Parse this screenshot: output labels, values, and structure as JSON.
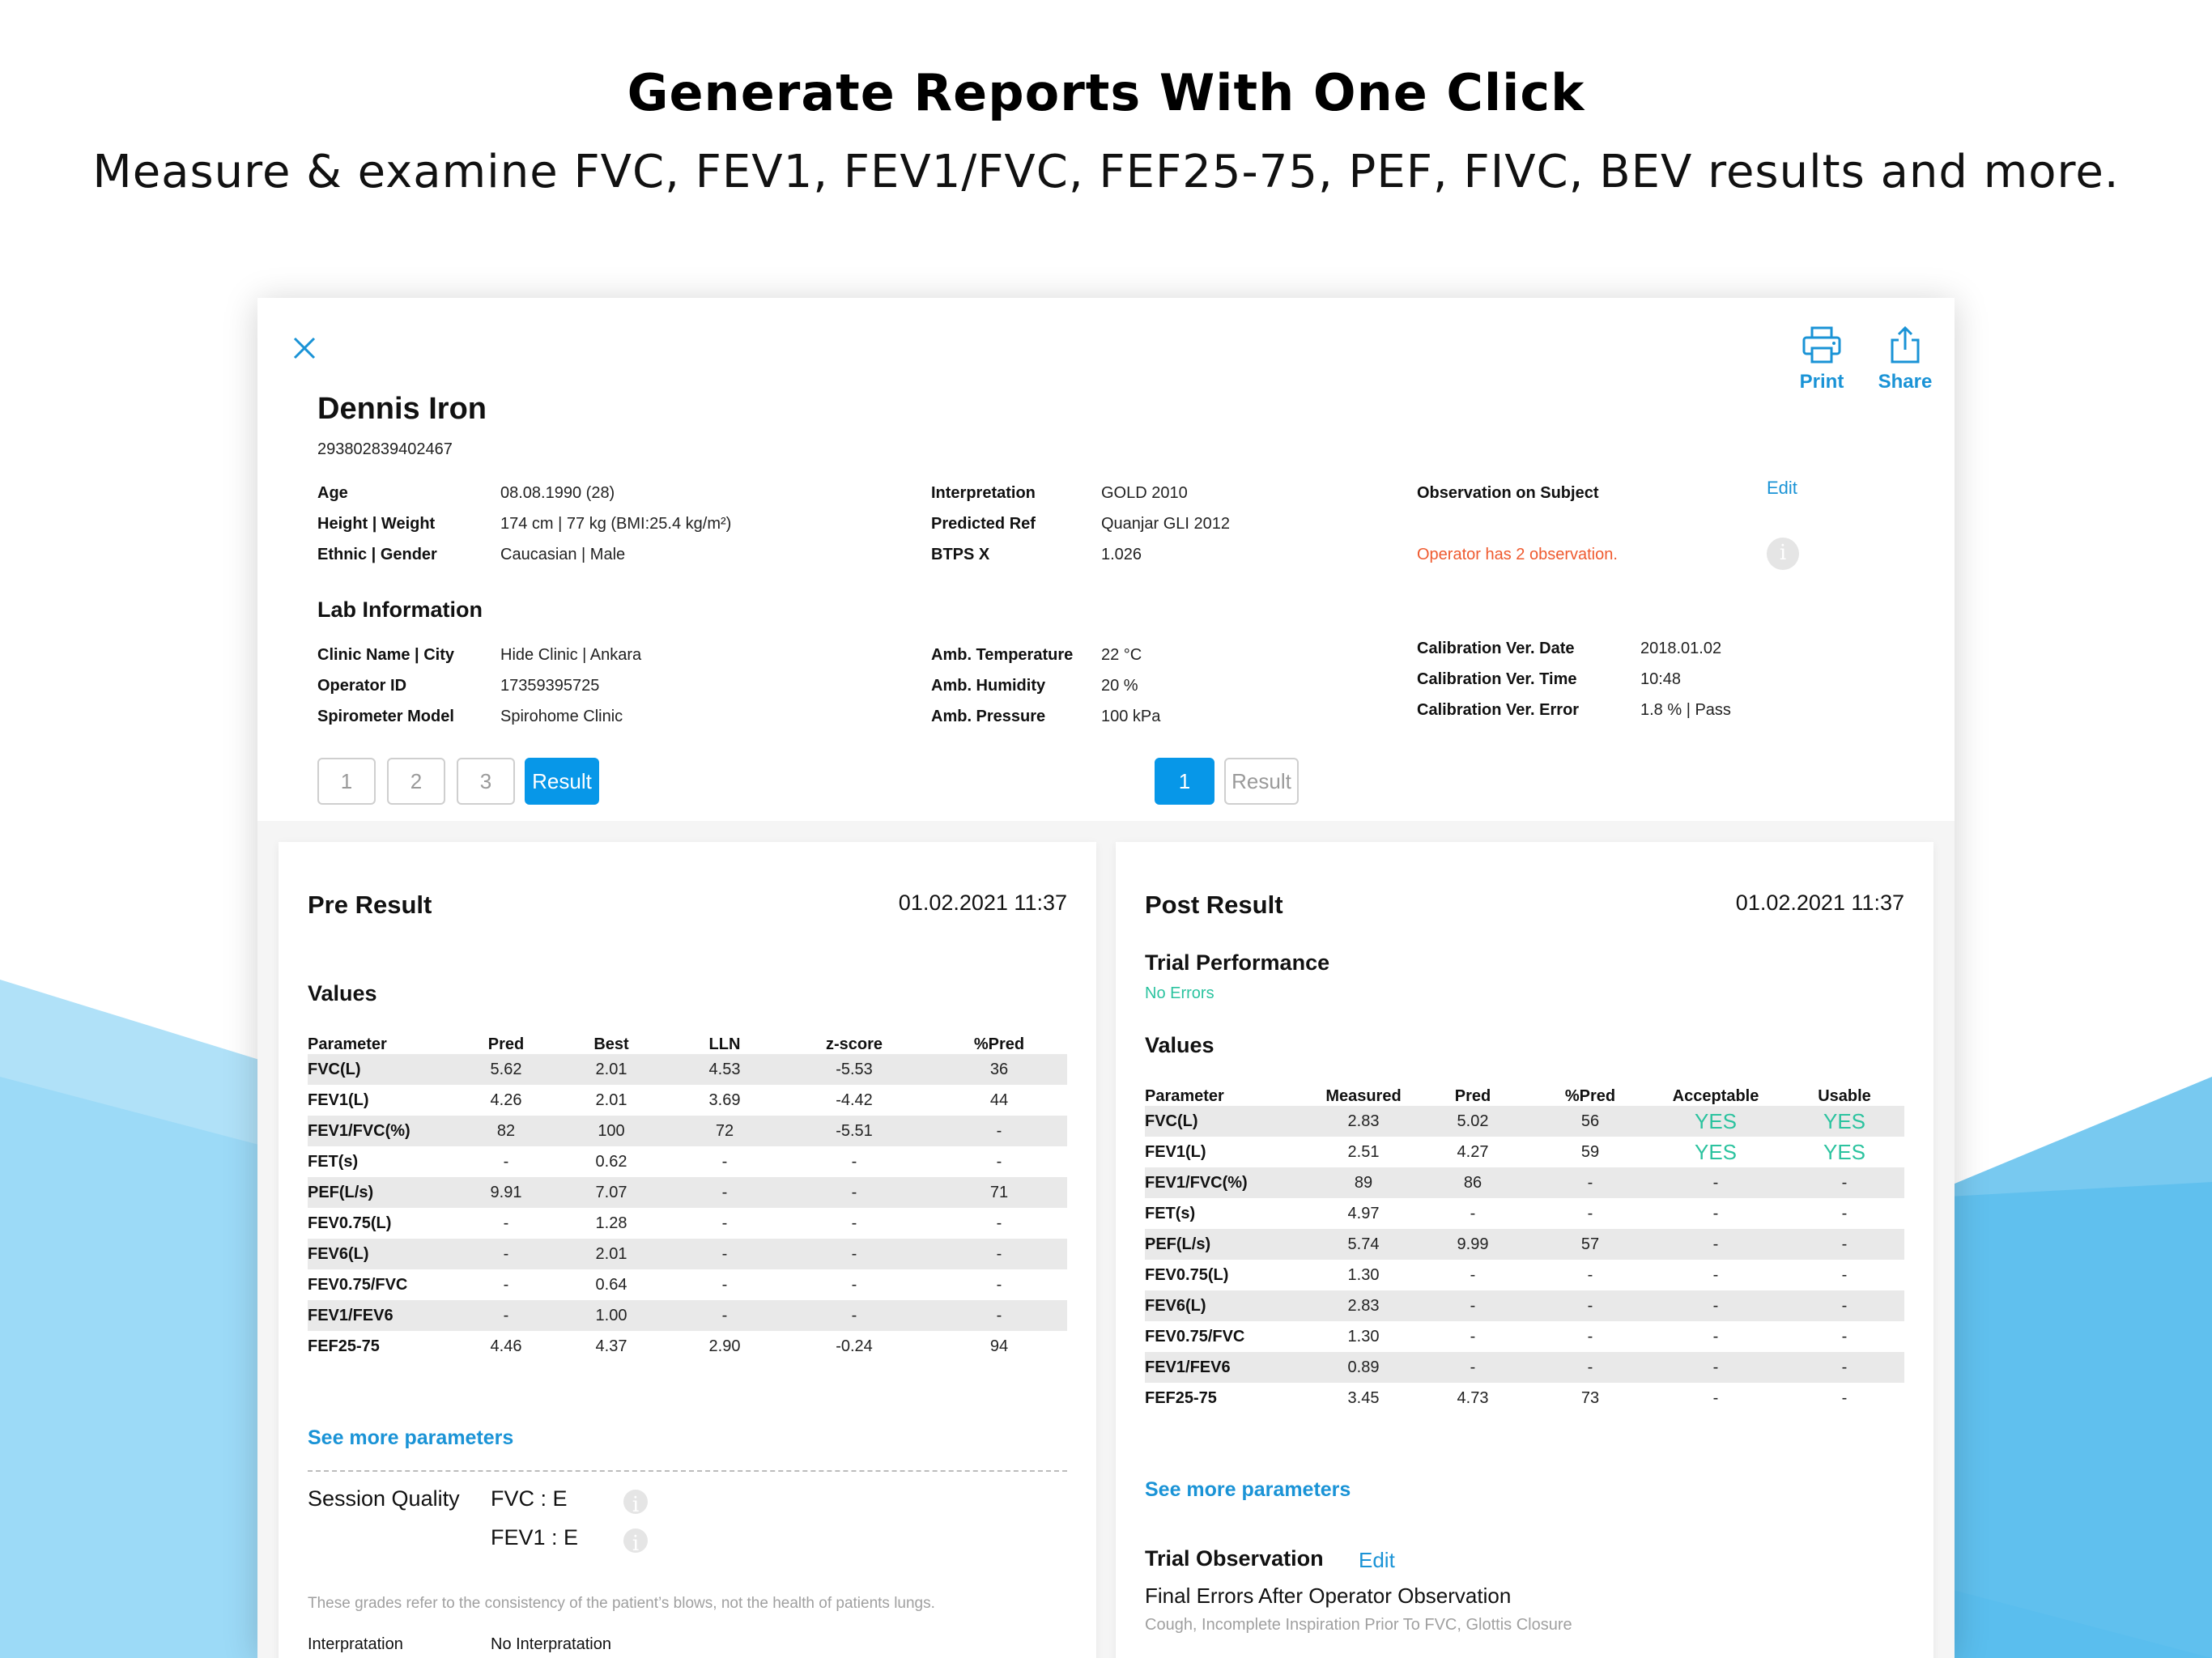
{
  "hero": {
    "title": "Generate Reports With One Click",
    "subtitle": "Measure & examine FVC, FEV1, FEV1/FVC, FEF25-75, PEF, FIVC, BEV results and more."
  },
  "toolbar": {
    "print_label": "Print",
    "share_label": "Share"
  },
  "patient": {
    "name": "Dennis Iron",
    "id": "293802839402467"
  },
  "subject_info": {
    "age_label": "Age",
    "age_value": "08.08.1990 (28)",
    "hw_label": "Height | Weight",
    "hw_value": "174 cm | 77 kg  (BMI:25.4 kg/m²)",
    "eg_label": "Ethnic | Gender",
    "eg_value": "Caucasian | Male",
    "interp_label": "Interpretation",
    "interp_value": "GOLD 2010",
    "pref_label": "Predicted Ref",
    "pref_value": "Quanjar GLI 2012",
    "btps_label": "BTPS X",
    "btps_value": "1.026"
  },
  "observation": {
    "label": "Observation on Subject",
    "edit": "Edit",
    "warning": "Operator has 2 observation."
  },
  "lab": {
    "title": "Lab Information",
    "clinic_label": "Clinic Name | City",
    "clinic_value": "Hide Clinic | Ankara",
    "op_label": "Operator ID",
    "op_value": "17359395725",
    "spiro_label": "Spirometer Model",
    "spiro_value": "Spirohome Clinic",
    "temp_label": "Amb. Temperature",
    "temp_value": "22 °C",
    "hum_label": "Amb. Humidity",
    "hum_value": "20 %",
    "press_label": "Amb. Pressure",
    "press_value": "100 kPa",
    "cal_date_label": "Calibration Ver. Date",
    "cal_date_value": "2018.01.02",
    "cal_time_label": "Calibration Ver. Time",
    "cal_time_value": "10:48",
    "cal_err_label": "Calibration Ver. Error",
    "cal_err_value": "1.8 % | Pass"
  },
  "pager_left": [
    "1",
    "2",
    "3",
    "Result"
  ],
  "pager_right": [
    "1",
    "Result"
  ],
  "pre": {
    "title": "Pre Result",
    "date": "01.02.2021 11:37",
    "values_title": "Values",
    "headers": [
      "Parameter",
      "Pred",
      "Best",
      "LLN",
      "z-score",
      "%Pred"
    ],
    "rows": [
      [
        "FVC(L)",
        "5.62",
        "2.01",
        "4.53",
        "-5.53",
        "36"
      ],
      [
        "FEV1(L)",
        "4.26",
        "2.01",
        "3.69",
        "-4.42",
        "44"
      ],
      [
        "FEV1/FVC(%)",
        "82",
        "100",
        "72",
        "-5.51",
        "-"
      ],
      [
        "FET(s)",
        "-",
        "0.62",
        "-",
        "-",
        "-"
      ],
      [
        "PEF(L/s)",
        "9.91",
        "7.07",
        "-",
        "-",
        "71"
      ],
      [
        "FEV0.75(L)",
        "-",
        "1.28",
        "-",
        "-",
        "-"
      ],
      [
        "FEV6(L)",
        "-",
        "2.01",
        "-",
        "-",
        "-"
      ],
      [
        "FEV0.75/FVC",
        "-",
        "0.64",
        "-",
        "-",
        "-"
      ],
      [
        "FEV1/FEV6",
        "-",
        "1.00",
        "-",
        "-",
        "-"
      ],
      [
        "FEF25-75",
        "4.46",
        "4.37",
        "2.90",
        "-0.24",
        "94"
      ]
    ],
    "more": "See more parameters",
    "sq_label": "Session Quality",
    "sq_fvc": "FVC : E",
    "sq_fev1": "FEV1 : E",
    "note": "These grades refer to the consistency of the patient’s blows, not the health of patients lungs.",
    "interp_label": "Interpratation",
    "interp_value": "No Interpratation"
  },
  "post": {
    "title": "Post Result",
    "date": "01.02.2021 11:37",
    "trial_title": "Trial Performance",
    "trial_status": "No Errors",
    "values_title": "Values",
    "headers": [
      "Parameter",
      "Measured",
      "Pred",
      "%Pred",
      "Acceptable",
      "Usable"
    ],
    "rows": [
      [
        "FVC(L)",
        "2.83",
        "5.02",
        "56",
        "YES",
        "YES"
      ],
      [
        "FEV1(L)",
        "2.51",
        "4.27",
        "59",
        "YES",
        "YES"
      ],
      [
        "FEV1/FVC(%)",
        "89",
        "86",
        "-",
        "-",
        "-"
      ],
      [
        "FET(s)",
        "4.97",
        "-",
        "-",
        "-",
        "-"
      ],
      [
        "PEF(L/s)",
        "5.74",
        "9.99",
        "57",
        "-",
        "-"
      ],
      [
        "FEV0.75(L)",
        "1.30",
        "-",
        "-",
        "-",
        "-"
      ],
      [
        "FEV6(L)",
        "2.83",
        "-",
        "-",
        "-",
        "-"
      ],
      [
        "FEV0.75/FVC",
        "1.30",
        "-",
        "-",
        "-",
        "-"
      ],
      [
        "FEV1/FEV6",
        "0.89",
        "-",
        "-",
        "-",
        "-"
      ],
      [
        "FEF25-75",
        "3.45",
        "4.73",
        "73",
        "-",
        "-"
      ]
    ],
    "more": "See more parameters",
    "obs_title": "Trial Observation",
    "obs_edit": "Edit",
    "obs_line": "Final Errors After Operator Observation",
    "obs_detail": "Cough, Incomplete Inspiration Prior To FVC, Glottis Closure"
  },
  "colors": {
    "accent": "#0797e8",
    "link": "#1a93d6",
    "warning": "#ef5a2f",
    "ok": "#2bc39f"
  }
}
